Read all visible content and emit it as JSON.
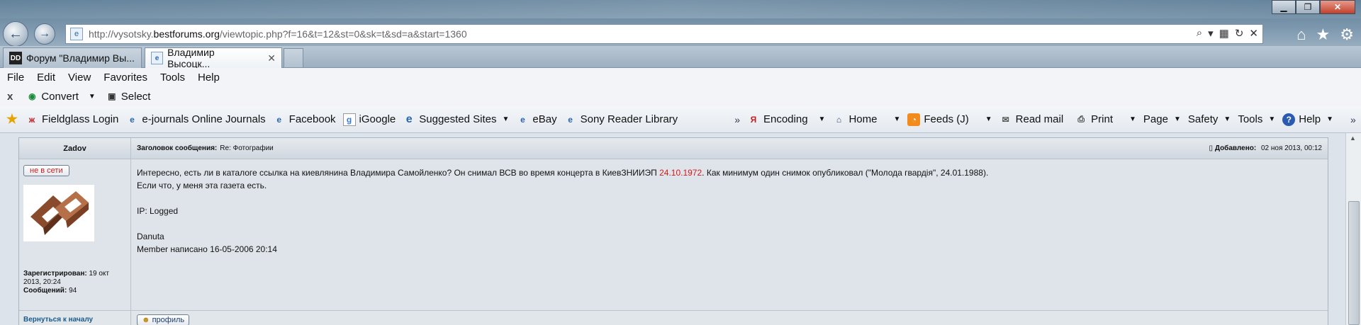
{
  "window": {
    "minimize_label": "▁",
    "maximize_label": "❐",
    "close_label": "✕"
  },
  "nav": {
    "back_icon": "←",
    "forward_icon": "→"
  },
  "address": {
    "url_prefix": "http://vysotsky.",
    "url_domain": "bestforums.org",
    "url_suffix": "/viewtopic.php?f=16&t=12&st=0&sk=t&sd=a&start=1360"
  },
  "tabs": [
    {
      "label": "Форум \"Владимир Вы...",
      "favicon": "DD"
    },
    {
      "label": "Владимир Высоцк...",
      "favicon": "e"
    }
  ],
  "menu": [
    "File",
    "Edit",
    "View",
    "Favorites",
    "Tools",
    "Help"
  ],
  "cmdbar": {
    "close": "x",
    "convert": "Convert",
    "select": "Select"
  },
  "favorites": [
    "Fieldglass Login",
    "e-journals Online Journals",
    "Facebook",
    "iGoogle",
    "Suggested Sites",
    "eBay",
    "Sony Reader Library"
  ],
  "rightbar": {
    "encoding": "Encoding",
    "home": "Home",
    "feeds": "Feeds (J)",
    "read_mail": "Read mail",
    "print": "Print",
    "page": "Page",
    "safety": "Safety",
    "tools": "Tools",
    "help": "Help"
  },
  "post": {
    "author": "Zadov",
    "subject_label": "Заголовок сообщения:",
    "subject": "Re: Фотографии",
    "added_label": "Добавлено:",
    "added_date": "02 ноя 2013, 00:12",
    "status": "не в сети",
    "registered_label": "Зарегистрирован:",
    "registered_value": "19 окт",
    "registered_value2": "2013, 20:24",
    "messages_label": "Сообщений:",
    "messages_value": "94",
    "text_part1": "Интересно, есть ли в каталоге ссылка на киевлянина Владимира Самойленко? Он снимал ВСВ во время концерта в КиевЗНИИЭП ",
    "text_date": "24.10.1972",
    "text_part2": ". Как минимум один снимок опубликовал (\"Молода гвардія\", 24.01.1988).",
    "line2": "Если что, у меня эта газета есть.",
    "ip": "IP: Logged",
    "signature_name": "Danuta",
    "signature_line": "Member написано 16-05-2006 20:14",
    "back_to_top": "Вернуться к началу",
    "profile": "профиль"
  }
}
